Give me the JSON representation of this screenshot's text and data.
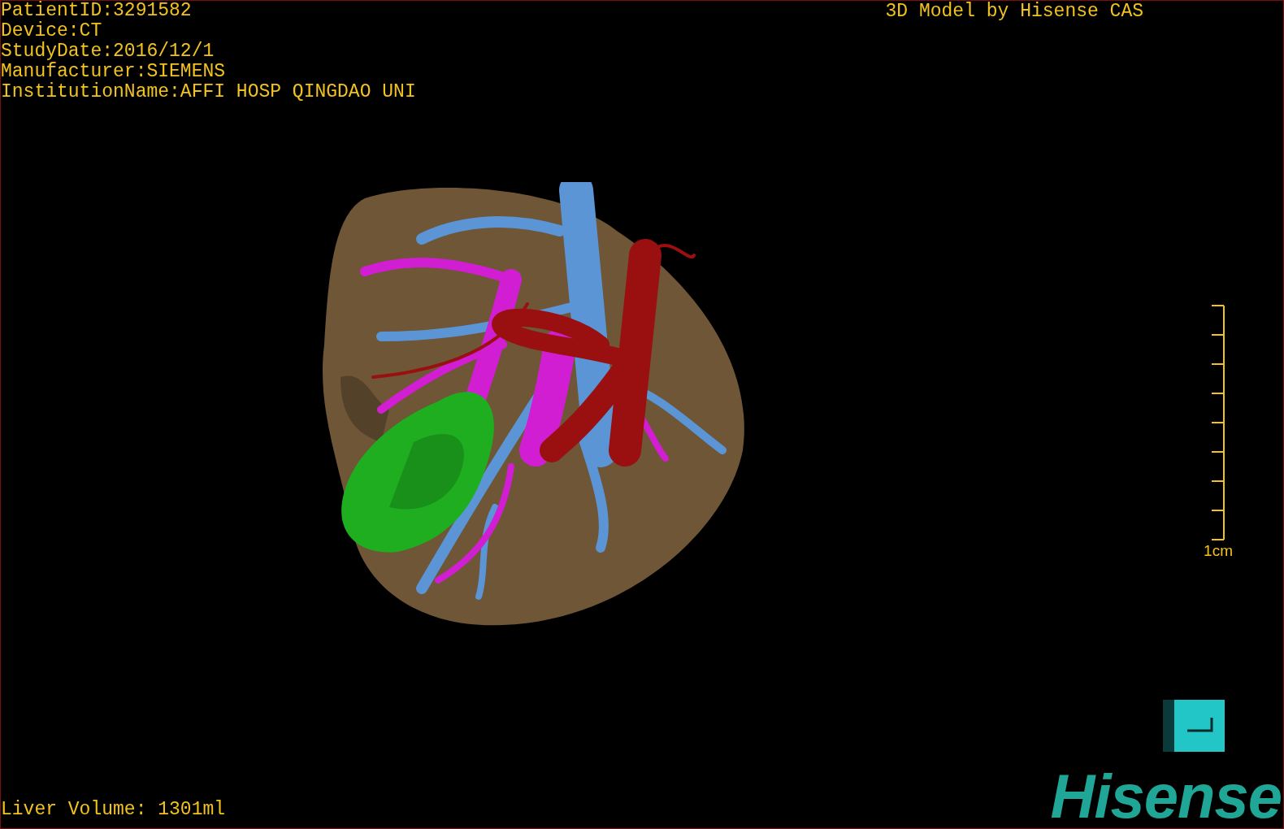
{
  "study_info": [
    "PatientID:3291582",
    "Device:CT",
    "StudyDate:2016/12/1",
    "Manufacturer:SIEMENS",
    "InstitutionName:AFFI HOSP QINGDAO UNI"
  ],
  "title": "3D Model by Hisense CAS",
  "scale_bar": {
    "label": "1cm"
  },
  "liver_volume": "Liver Volume: 1301ml",
  "logo": "Hisense"
}
